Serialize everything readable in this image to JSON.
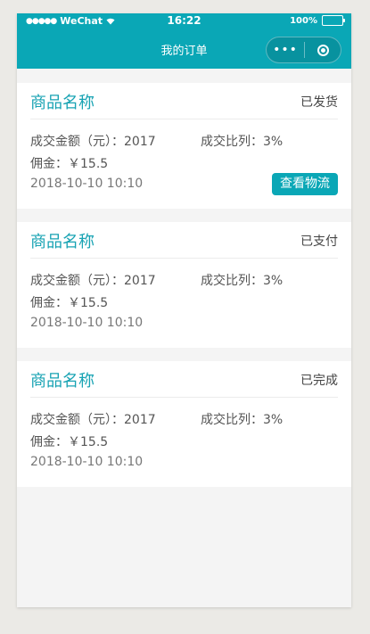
{
  "status_bar": {
    "signal": "●●●●●",
    "carrier": "WeChat",
    "time": "16:22",
    "battery": "100%"
  },
  "nav": {
    "title": "我的订单",
    "more": "•••"
  },
  "labels": {
    "amount_prefix": "成交金额（元）：",
    "ratio_prefix": "成交比列：",
    "commission_prefix": "佣金：￥"
  },
  "orders": [
    {
      "name": "商品名称",
      "status": "已发货",
      "amount": "2017",
      "ratio": "3%",
      "commission": "15.5",
      "date": "2018-10-10 10:10",
      "action": "查看物流"
    },
    {
      "name": "商品名称",
      "status": "已支付",
      "amount": "2017",
      "ratio": "3%",
      "commission": "15.5",
      "date": "2018-10-10 10:10"
    },
    {
      "name": "商品名称",
      "status": "已完成",
      "amount": "2017",
      "ratio": "3%",
      "commission": "15.5",
      "date": "2018-10-10 10:10"
    }
  ],
  "colors": {
    "accent": "#0aa7b6",
    "title_text": "#18a3b3",
    "page_bg": "#f4f4f4",
    "outer_bg": "#ebeae6"
  }
}
